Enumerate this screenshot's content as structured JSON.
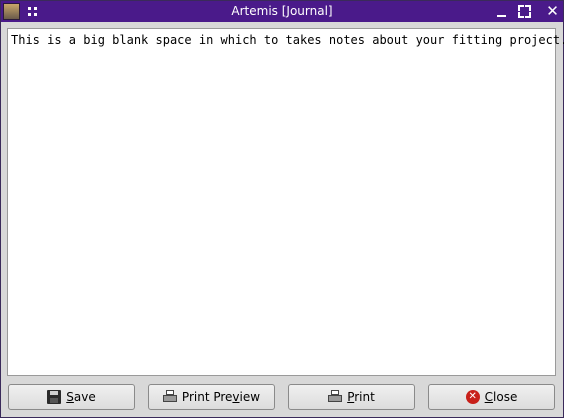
{
  "window": {
    "title": "Artemis [Journal]"
  },
  "titlebar": {
    "close_glyph": "✕"
  },
  "editor": {
    "text": "This is a big blank space in which to takes notes about your fitting project."
  },
  "buttons": {
    "save": {
      "mnemonic": "S",
      "rest": "ave"
    },
    "preview": {
      "before": "Print Pre",
      "mnemonic": "v",
      "after": "iew"
    },
    "print": {
      "mnemonic": "P",
      "rest": "rint"
    },
    "close": {
      "mnemonic": "C",
      "rest": "lose"
    }
  },
  "colors": {
    "titlebar": "#4a1a8a",
    "background": "#d8d8d8"
  },
  "icons": {
    "save": "floppy-disk-icon",
    "preview": "printer-icon",
    "print": "printer-icon",
    "close": "close-circle-icon"
  }
}
